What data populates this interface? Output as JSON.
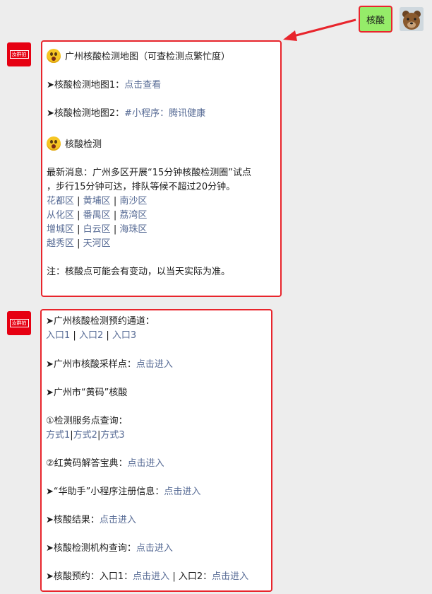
{
  "brand_avatar_text": "汝群拍",
  "sent_message": "核酸",
  "colors": {
    "accent_red": "#e8252c",
    "link": "#576b95",
    "sent_bg": "#95ec69"
  },
  "msg1": {
    "title": "广州核酸检测地图（可查检测点繁忙度）",
    "map1_label": "➤核酸检测地图1：",
    "map1_link": "点击查看",
    "map2_label": "➤核酸检测地图2：",
    "map2_link": "#小程序：腾讯健康",
    "section2_title": "核酸检测",
    "news_line1": "最新消息：广州多区开展“15分钟核酸检测圈”试点",
    "news_line2": "，步行15分钟可达，排队等候不超过20分钟。",
    "districts": [
      [
        "花都区",
        "黄埔区",
        "南沙区"
      ],
      [
        "从化区",
        "番禺区",
        "荔湾区"
      ],
      [
        "增城区",
        "白云区",
        "海珠区"
      ],
      [
        "越秀区",
        "天河区"
      ]
    ],
    "note": "注：核酸点可能会有变动，以当天实际为准。"
  },
  "msg2": {
    "booking_label": "➤广州核酸检测预约通道：",
    "entries": [
      "入口1",
      "入口2",
      "入口3"
    ],
    "sampling_label": "➤广州市核酸采样点：",
    "sampling_link": "点击进入",
    "yellow_code": "➤广州市“黄码”核酸",
    "service_query": "①检测服务点查询：",
    "methods": [
      "方式1",
      "方式2",
      "方式3"
    ],
    "redyellow_label": "②红黄码解答宝典：",
    "redyellow_link": "点击进入",
    "huazhushou_label": "➤“华助手”小程序注册信息：",
    "huazhushou_link": "点击进入",
    "result_label": "➤核酸结果：",
    "result_link": "点击进入",
    "institution_label": "➤核酸检测机构查询：",
    "institution_link": "点击进入",
    "appointment_label": "➤核酸预约：入口1：",
    "appointment_link1": "点击进入",
    "appointment_mid": " | 入口2：",
    "appointment_link2": "点击进入"
  }
}
